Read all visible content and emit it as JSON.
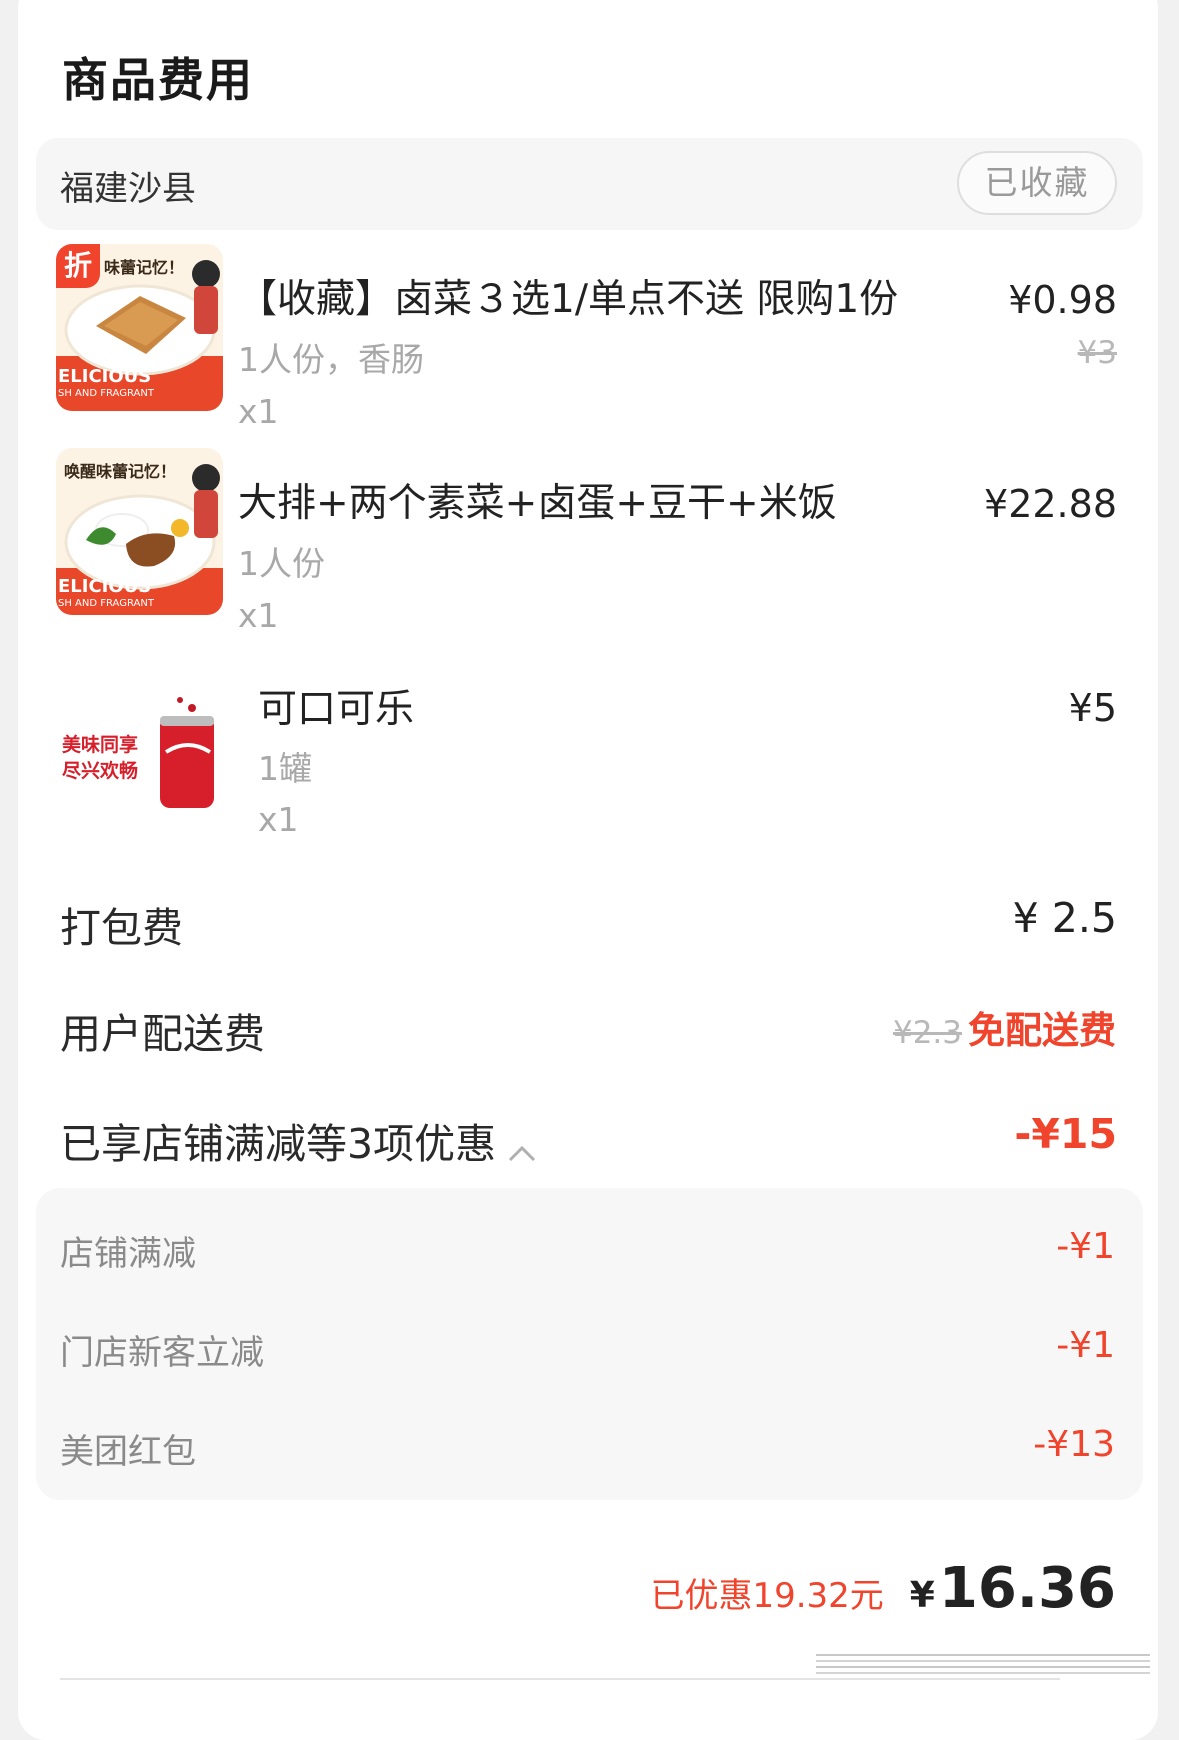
{
  "section_title": "商品费用",
  "store": {
    "name": "福建沙县",
    "favorite_label": "已收藏"
  },
  "items": [
    {
      "name": "【收藏】卤菜３选1/单点不送 限购1份",
      "spec": "1人份，香肠",
      "qty": "x1",
      "price": "¥0.98",
      "original_price": "¥3",
      "discount_badge": "折",
      "thumb_banner": "味蕾记忆！",
      "thumb_caption": "ELICIOUS",
      "thumb_sub": "SH AND FRAGRANT"
    },
    {
      "name": "大排+两个素菜+卤蛋+豆干+米饭",
      "spec": "1人份",
      "qty": "x1",
      "price": "¥22.88",
      "thumb_banner": "唤醒味蕾记忆！",
      "thumb_caption": "ELICIOUS",
      "thumb_sub": "SH AND FRAGRANT"
    },
    {
      "name": "可口可乐",
      "spec": "1罐",
      "qty": "x1",
      "price": "¥5",
      "thumb_banner": "美味同享",
      "thumb_caption": "尽兴欢畅"
    }
  ],
  "packing_fee": {
    "label": "打包费",
    "value": "¥ 2.5"
  },
  "delivery_fee": {
    "label": "用户配送费",
    "original": "¥2.3",
    "value": "免配送费"
  },
  "discounts": {
    "summary_label": "已享店铺满减等3项优惠",
    "summary_value": "-¥15",
    "items": [
      {
        "label": "店铺满减",
        "value": "-¥1"
      },
      {
        "label": "门店新客立减",
        "value": "-¥1"
      },
      {
        "label": "美团红包",
        "value": "-¥13"
      }
    ]
  },
  "total": {
    "saved": "已优惠19.32元",
    "currency": "¥",
    "amount": "16.36"
  },
  "colors": {
    "accent": "#f0442d",
    "muted": "#a8a8a8",
    "card": "#ffffff",
    "panel": "#f7f7f7"
  },
  "icons": {
    "expand": "chevron-up-icon"
  }
}
